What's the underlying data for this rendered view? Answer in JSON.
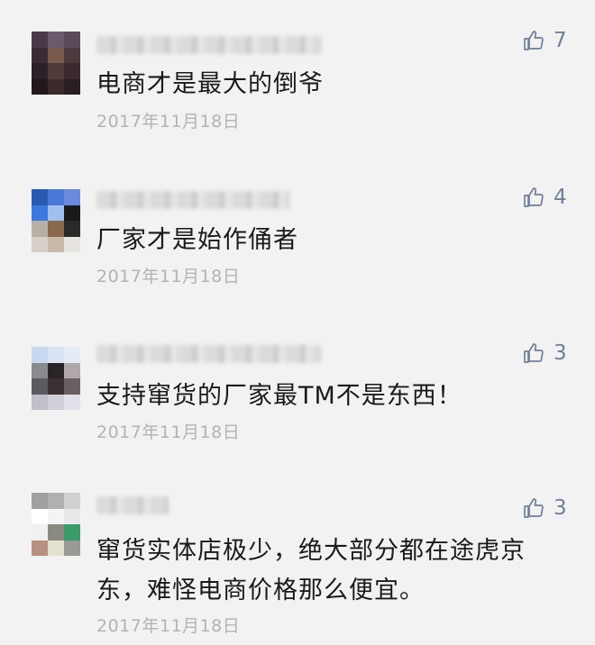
{
  "comments": [
    {
      "text": "电商才是最大的倒爷",
      "date": "2017年11月18日",
      "likes": "7",
      "avatar_colors": [
        "#4a3a4a",
        "#6a5a6c",
        "#5a4a5a",
        "#3a2c34",
        "#7a5a4c",
        "#4c3a3e",
        "#2c2028",
        "#503a3a",
        "#3a2a30",
        "#22181c",
        "#3c2a2c",
        "#2a1e22"
      ]
    },
    {
      "text": "厂家才是始作俑者",
      "date": "2017年11月18日",
      "likes": "4",
      "avatar_colors": [
        "#2a5ab0",
        "#4a7ad8",
        "#6a8ae0",
        "#3a7ae0",
        "#a0c0f0",
        "#1a1a1a",
        "#b8b0a8",
        "#8a6a4a",
        "#2a2a2a",
        "#d8d0c8",
        "#c8b8a8",
        "#e8e4e0"
      ]
    },
    {
      "text": "支持窜货的厂家最TM不是东西！",
      "date": "2017年11月18日",
      "likes": "3",
      "avatar_colors": [
        "#c8d8f0",
        "#d8e4f4",
        "#e4ecf8",
        "#8a8a90",
        "#2a2428",
        "#b0a8a8",
        "#5a5a60",
        "#3a3034",
        "#6a6064",
        "#c0c0c8",
        "#d0d0d8",
        "#e0e0e8"
      ]
    },
    {
      "text": "窜货实体店极少，绝大部分都在途虎京东，难怪电商价格那么便宜。",
      "date": "2017年11月18日",
      "likes": "3",
      "avatar_colors": [
        "#a0a0a0",
        "#b0b0b0",
        "#d0d0d0",
        "#ffffff",
        "#f4f4f4",
        "#e8e8e8",
        "#f0f0f0",
        "#8a8a80",
        "#3a9a6a",
        "#b89080",
        "#e4e0d0",
        "#9a9a94"
      ]
    }
  ]
}
